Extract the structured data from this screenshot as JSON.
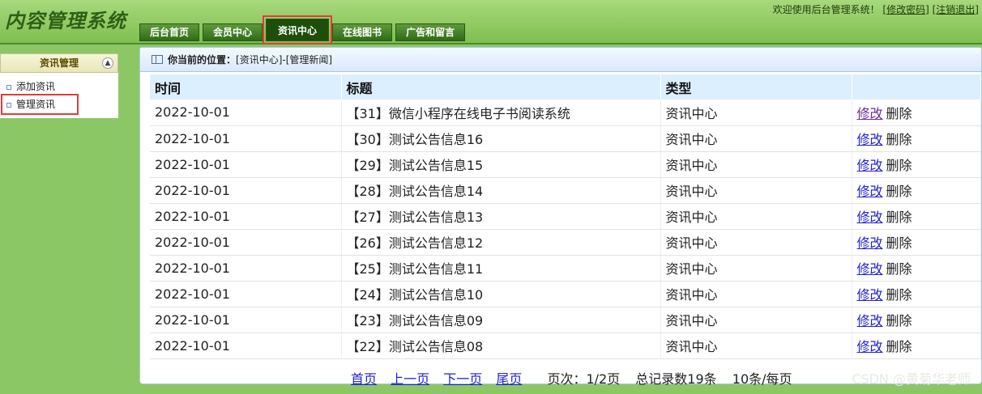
{
  "app_title": "内容管理系统",
  "header": {
    "welcome": "欢迎使用后台管理系统！",
    "change_password": "[修改密码]",
    "logout": "[注销退出]"
  },
  "tabs": [
    "后台首页",
    "会员中心",
    "资讯中心",
    "在线图书",
    "广告和留言"
  ],
  "sidebar": {
    "title": "资讯管理",
    "items": [
      "添加资讯",
      "管理资讯"
    ]
  },
  "breadcrumb": {
    "prefix": "你当前的位置：",
    "path": "[资讯中心]-[管理新闻]"
  },
  "table": {
    "headers": [
      "时间",
      "标题",
      "类型",
      ""
    ],
    "rows": [
      {
        "date": "2022-10-01",
        "title": "【31】微信小程序在线电子书阅读系统",
        "type": "资讯中心",
        "edit": "修改",
        "delete": "删除"
      },
      {
        "date": "2022-10-01",
        "title": "【30】测试公告信息16",
        "type": "资讯中心",
        "edit": "修改",
        "delete": "删除"
      },
      {
        "date": "2022-10-01",
        "title": "【29】测试公告信息15",
        "type": "资讯中心",
        "edit": "修改",
        "delete": "删除"
      },
      {
        "date": "2022-10-01",
        "title": "【28】测试公告信息14",
        "type": "资讯中心",
        "edit": "修改",
        "delete": "删除"
      },
      {
        "date": "2022-10-01",
        "title": "【27】测试公告信息13",
        "type": "资讯中心",
        "edit": "修改",
        "delete": "删除"
      },
      {
        "date": "2022-10-01",
        "title": "【26】测试公告信息12",
        "type": "资讯中心",
        "edit": "修改",
        "delete": "删除"
      },
      {
        "date": "2022-10-01",
        "title": "【25】测试公告信息11",
        "type": "资讯中心",
        "edit": "修改",
        "delete": "删除"
      },
      {
        "date": "2022-10-01",
        "title": "【24】测试公告信息10",
        "type": "资讯中心",
        "edit": "修改",
        "delete": "删除"
      },
      {
        "date": "2022-10-01",
        "title": "【23】测试公告信息09",
        "type": "资讯中心",
        "edit": "修改",
        "delete": "删除"
      },
      {
        "date": "2022-10-01",
        "title": "【22】测试公告信息08",
        "type": "资讯中心",
        "edit": "修改",
        "delete": "删除"
      }
    ]
  },
  "pager": {
    "first": "首页",
    "prev": "上一页",
    "next": "下一页",
    "last": "尾页",
    "page_info": "页次：1/2页",
    "total": "总记录数19条",
    "per_page": "10条/每页"
  },
  "watermark": "CSDN @黄菊华老师"
}
